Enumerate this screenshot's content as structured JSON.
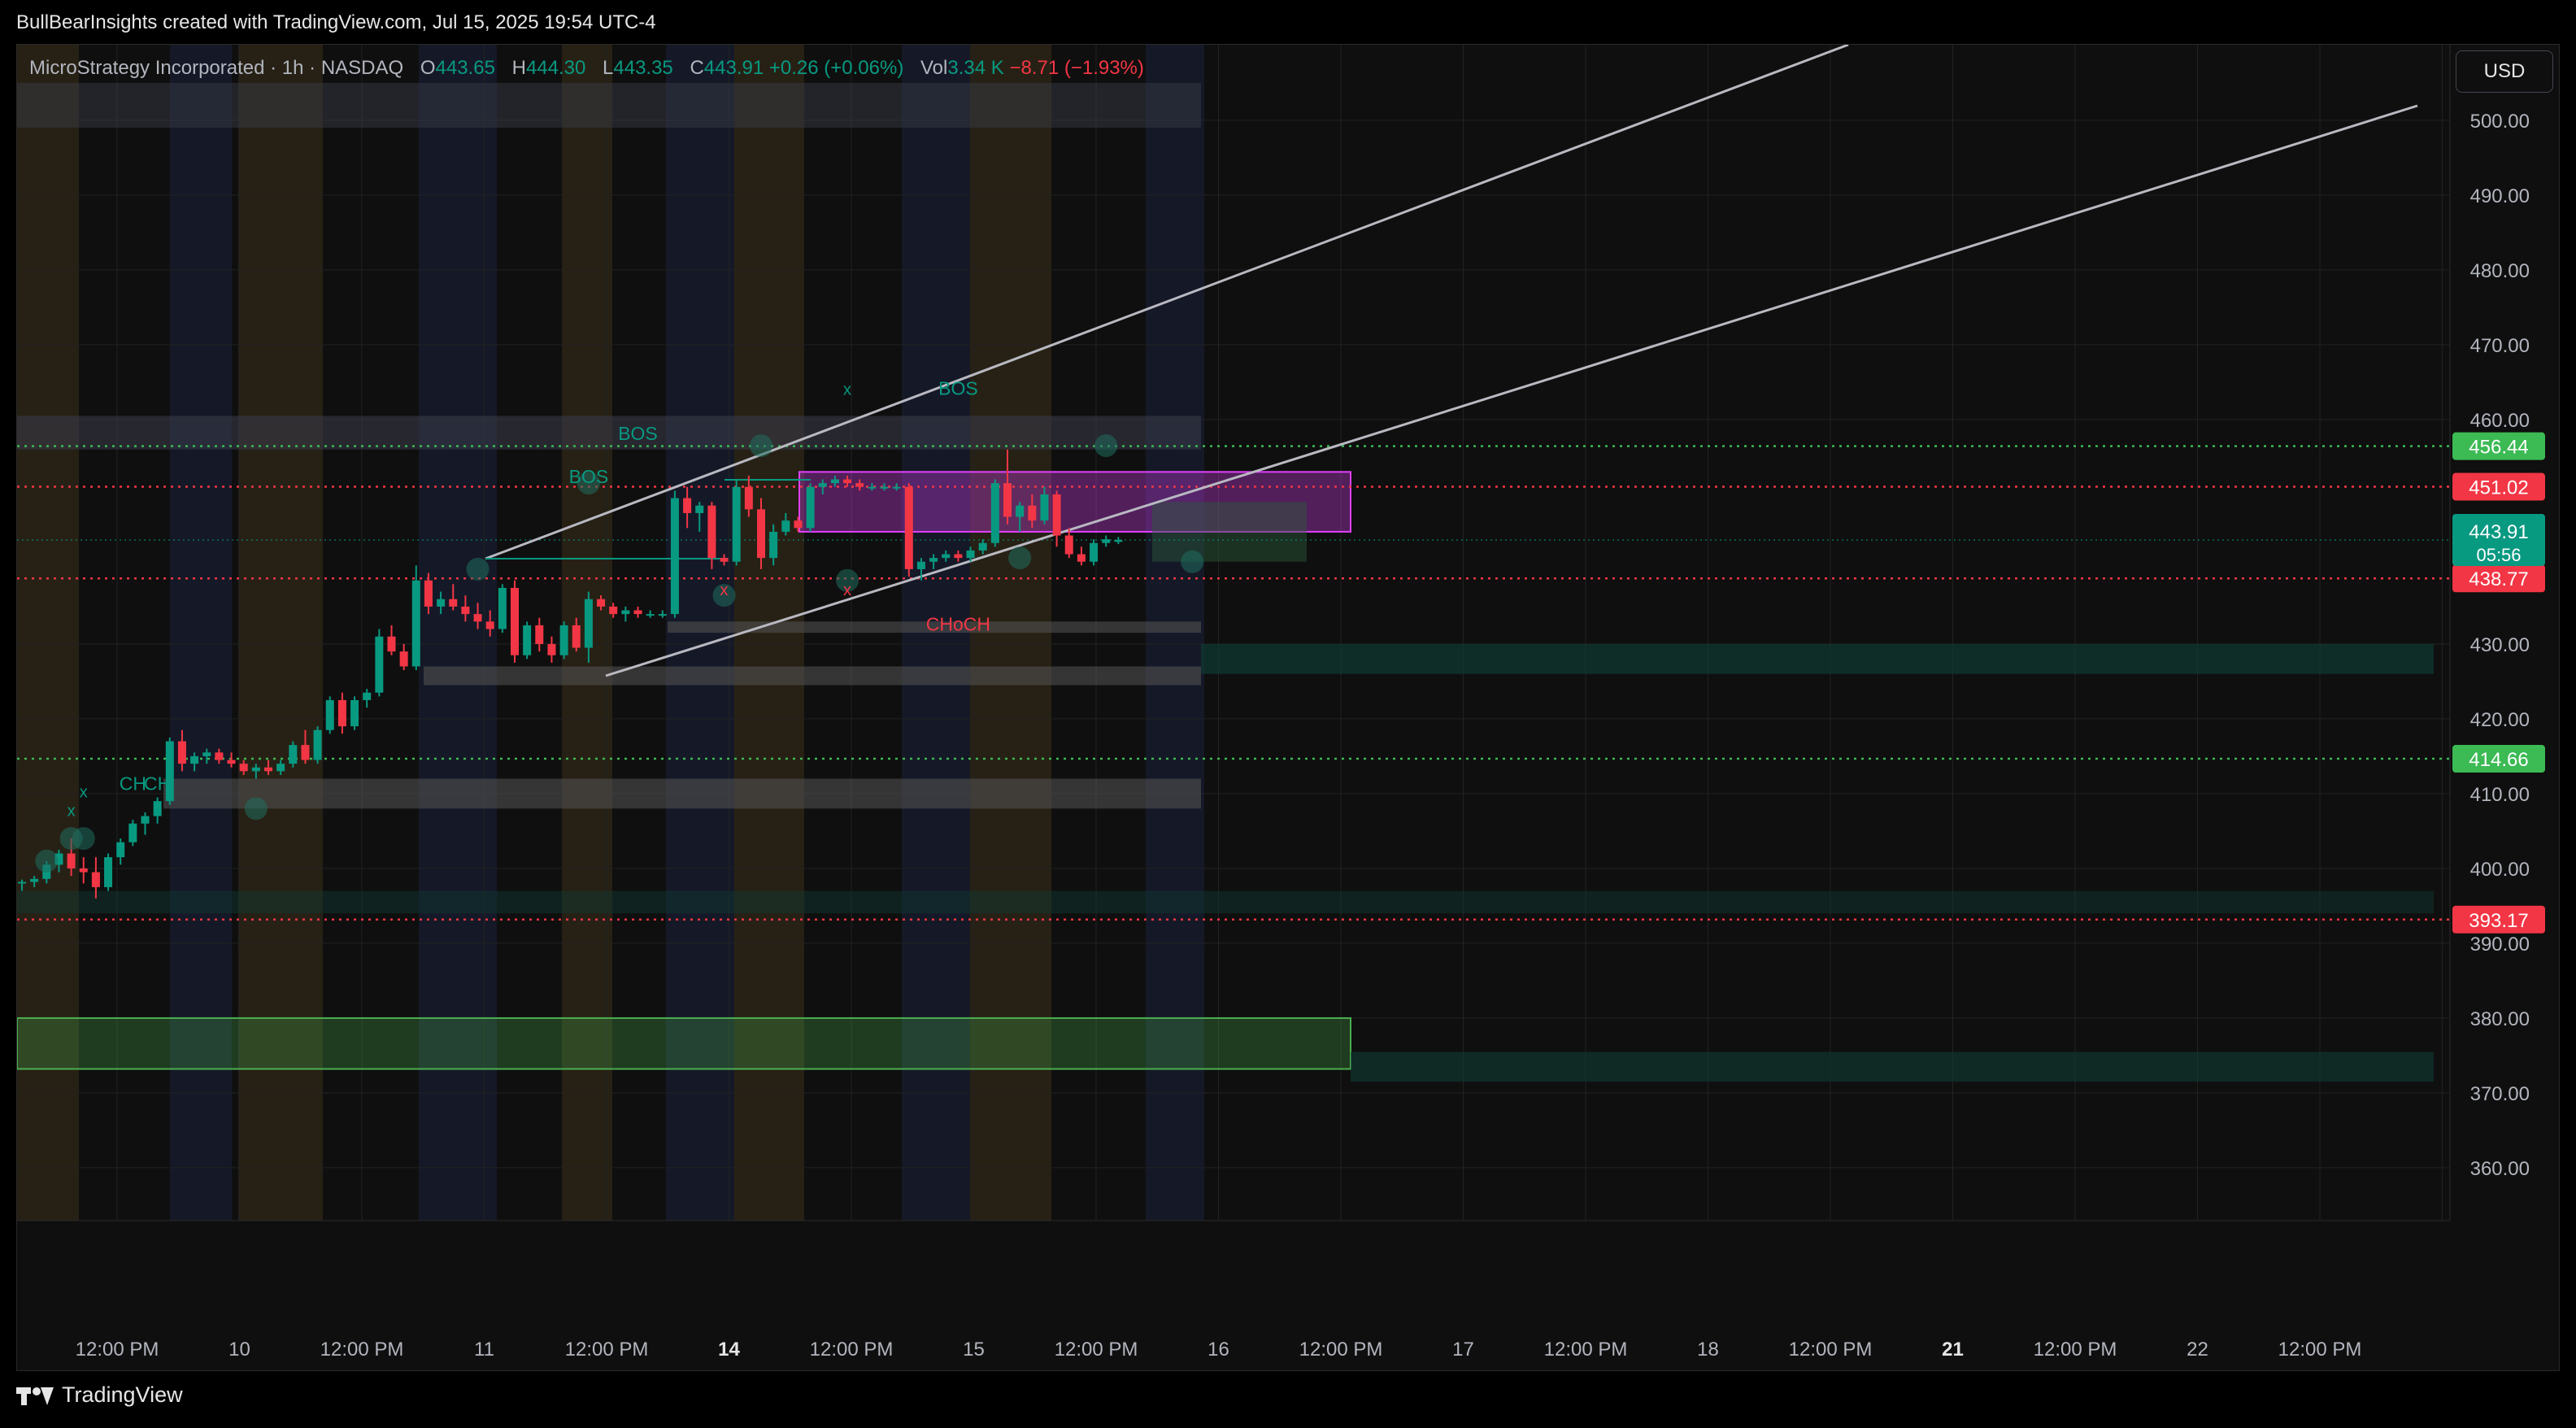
{
  "header": {
    "attribution": "BullBearInsights created with TradingView.com, Jul 15, 2025 19:54 UTC-4"
  },
  "legend": {
    "symbol": "MicroStrategy Incorporated · 1h · NASDAQ",
    "o_label": "O",
    "o_value": "443.65",
    "h_label": "H",
    "h_value": "444.30",
    "l_label": "L",
    "l_value": "443.35",
    "c_label": "C",
    "c_value": "443.91",
    "change": "+0.26 (+0.06%)",
    "vol_label": "Vol",
    "vol_value": "3.34 K",
    "vol_change": "−8.71 (−1.93%)"
  },
  "currency": "USD",
  "footer": {
    "brand": "TradingView"
  },
  "colors": {
    "up": "#089981",
    "down": "#f23645",
    "green_level": "#3cba54",
    "red_level": "#f23645",
    "channel": "#b9b9c2",
    "fvg_magenta": "#e040fb",
    "demand_green": "#4caf50"
  },
  "chart_data": {
    "type": "candlestick",
    "timeframe": "1h",
    "ylim": [
      345,
      505
    ],
    "y_ticks": [
      500,
      490,
      480,
      470,
      460,
      430,
      420,
      410,
      400,
      390,
      380,
      370,
      360
    ],
    "x_ticks": [
      {
        "label": "12:00 PM",
        "bold": false
      },
      {
        "label": "10",
        "bold": false
      },
      {
        "label": "12:00 PM",
        "bold": false
      },
      {
        "label": "11",
        "bold": false
      },
      {
        "label": "12:00 PM",
        "bold": false
      },
      {
        "label": "14",
        "bold": true
      },
      {
        "label": "12:00 PM",
        "bold": false
      },
      {
        "label": "15",
        "bold": false
      },
      {
        "label": "12:00 PM",
        "bold": false
      },
      {
        "label": "16",
        "bold": false
      },
      {
        "label": "12:00 PM",
        "bold": false
      },
      {
        "label": "17",
        "bold": false
      },
      {
        "label": "12:00 PM",
        "bold": false
      },
      {
        "label": "18",
        "bold": false
      },
      {
        "label": "12:00 PM",
        "bold": false
      },
      {
        "label": "21",
        "bold": true
      },
      {
        "label": "12:00 PM",
        "bold": false
      },
      {
        "label": "22",
        "bold": false
      },
      {
        "label": "12:00 PM",
        "bold": false
      }
    ],
    "price_levels": [
      {
        "value": 456.44,
        "label": "456.44",
        "color": "#3cba54"
      },
      {
        "value": 451.02,
        "label": "451.02",
        "color": "#f23645"
      },
      {
        "value": 438.77,
        "label": "438.77",
        "color": "#f23645"
      },
      {
        "value": 414.66,
        "label": "414.66",
        "color": "#3cba54"
      },
      {
        "value": 393.17,
        "label": "393.17",
        "color": "#f23645"
      }
    ],
    "last_price": {
      "value": 443.91,
      "label": "443.91",
      "countdown": "05:56"
    },
    "candles": [
      [
        398.0,
        398.5,
        397.0,
        398.2
      ],
      [
        398.2,
        399.0,
        397.5,
        398.6
      ],
      [
        398.6,
        401.0,
        398.0,
        400.5
      ],
      [
        400.5,
        402.5,
        399.5,
        402.0
      ],
      [
        402.0,
        404.0,
        399.0,
        400.0
      ],
      [
        400.0,
        401.5,
        398.0,
        399.5
      ],
      [
        399.5,
        401.5,
        396.0,
        397.5
      ],
      [
        397.5,
        402.0,
        397.0,
        401.5
      ],
      [
        401.5,
        404.0,
        400.5,
        403.5
      ],
      [
        403.5,
        406.5,
        403.0,
        406.0
      ],
      [
        406.0,
        407.5,
        404.5,
        407.0
      ],
      [
        407.0,
        409.5,
        406.0,
        409.0
      ],
      [
        409.0,
        417.5,
        408.5,
        417.0
      ],
      [
        417.0,
        418.5,
        413.0,
        414.0
      ],
      [
        414.0,
        415.5,
        413.0,
        415.0
      ],
      [
        415.0,
        416.0,
        414.0,
        415.5
      ],
      [
        415.5,
        416.0,
        414.0,
        414.5
      ],
      [
        414.5,
        415.5,
        413.5,
        414.0
      ],
      [
        414.0,
        414.5,
        412.5,
        413.0
      ],
      [
        413.0,
        414.0,
        412.0,
        413.5
      ],
      [
        413.5,
        414.5,
        412.5,
        413.0
      ],
      [
        413.0,
        414.5,
        412.5,
        414.0
      ],
      [
        414.0,
        417.0,
        413.5,
        416.5
      ],
      [
        416.5,
        418.5,
        414.0,
        414.5
      ],
      [
        414.5,
        419.0,
        414.0,
        418.5
      ],
      [
        418.5,
        423.0,
        418.0,
        422.5
      ],
      [
        422.5,
        423.5,
        418.0,
        419.0
      ],
      [
        419.0,
        423.0,
        418.5,
        422.5
      ],
      [
        422.5,
        424.0,
        421.5,
        423.5
      ],
      [
        423.5,
        432.0,
        423.0,
        431.0
      ],
      [
        431.0,
        432.5,
        428.5,
        429.0
      ],
      [
        429.0,
        430.0,
        426.5,
        427.0
      ],
      [
        427.0,
        440.5,
        426.5,
        438.5
      ],
      [
        438.5,
        439.5,
        434.0,
        435.0
      ],
      [
        435.0,
        437.0,
        434.0,
        436.0
      ],
      [
        436.0,
        438.0,
        434.5,
        435.0
      ],
      [
        435.0,
        436.5,
        433.0,
        434.0
      ],
      [
        434.0,
        435.5,
        432.0,
        433.0
      ],
      [
        433.0,
        434.5,
        431.0,
        432.0
      ],
      [
        432.0,
        438.0,
        431.5,
        437.5
      ],
      [
        437.5,
        438.5,
        427.5,
        428.5
      ],
      [
        428.5,
        433.0,
        428.0,
        432.5
      ],
      [
        432.5,
        433.5,
        429.0,
        430.0
      ],
      [
        430.0,
        431.0,
        427.5,
        428.5
      ],
      [
        428.5,
        433.0,
        428.0,
        432.5
      ],
      [
        432.5,
        433.5,
        429.0,
        429.5
      ],
      [
        429.5,
        437.0,
        427.5,
        436.0
      ],
      [
        436.0,
        436.5,
        434.5,
        435.0
      ],
      [
        435.0,
        435.5,
        433.5,
        434.0
      ],
      [
        434.0,
        435.0,
        433.0,
        434.5
      ],
      [
        434.5,
        435.0,
        433.5,
        434.0
      ],
      [
        434.0,
        434.5,
        433.5,
        434.0
      ],
      [
        434.0,
        434.5,
        433.5,
        434.0
      ],
      [
        434.0,
        450.5,
        433.5,
        449.5
      ],
      [
        449.5,
        451.0,
        445.5,
        447.5
      ],
      [
        447.5,
        449.0,
        445.0,
        448.5
      ],
      [
        448.5,
        449.0,
        440.0,
        441.5
      ],
      [
        441.5,
        442.0,
        440.5,
        441.0
      ],
      [
        441.0,
        452.0,
        440.5,
        451.0
      ],
      [
        451.0,
        452.5,
        447.0,
        448.0
      ],
      [
        448.0,
        449.5,
        440.0,
        441.5
      ],
      [
        441.5,
        446.0,
        440.5,
        445.0
      ],
      [
        445.0,
        447.5,
        444.5,
        446.5
      ],
      [
        446.5,
        447.0,
        445.0,
        445.5
      ],
      [
        445.5,
        451.5,
        445.0,
        451.0
      ],
      [
        451.0,
        452.0,
        450.0,
        451.5
      ],
      [
        451.5,
        452.5,
        451.0,
        452.0
      ],
      [
        452.0,
        452.5,
        451.0,
        451.5
      ],
      [
        451.5,
        452.0,
        450.5,
        451.0
      ],
      [
        451.0,
        451.5,
        450.5,
        451.0
      ],
      [
        451.0,
        451.5,
        450.5,
        451.0
      ],
      [
        451.0,
        451.5,
        450.5,
        451.0
      ],
      [
        451.0,
        451.5,
        439.0,
        440.0
      ],
      [
        440.0,
        441.5,
        438.5,
        441.0
      ],
      [
        441.0,
        442.0,
        440.0,
        441.5
      ],
      [
        441.5,
        442.5,
        441.0,
        442.0
      ],
      [
        442.0,
        442.5,
        441.0,
        441.5
      ],
      [
        441.5,
        443.0,
        441.0,
        442.5
      ],
      [
        442.5,
        444.0,
        442.0,
        443.5
      ],
      [
        443.5,
        452.0,
        443.0,
        451.5
      ],
      [
        451.5,
        456.0,
        446.0,
        447.0
      ],
      [
        447.0,
        449.0,
        445.0,
        448.5
      ],
      [
        448.5,
        450.0,
        445.5,
        446.5
      ],
      [
        446.5,
        451.0,
        446.0,
        450.0
      ],
      [
        450.0,
        450.5,
        443.0,
        444.5
      ],
      [
        444.5,
        445.5,
        441.5,
        442.0
      ],
      [
        442.0,
        443.0,
        440.5,
        441.0
      ],
      [
        441.0,
        444.0,
        440.5,
        443.5
      ],
      [
        443.5,
        444.5,
        443.0,
        444.0
      ],
      [
        443.65,
        444.3,
        443.35,
        443.91
      ]
    ],
    "annotations": [
      {
        "text": "BOS",
        "color": "#089981",
        "bar": 46,
        "price": 451.5
      },
      {
        "text": "BOS",
        "color": "#089981",
        "bar": 50,
        "price": 457.3
      },
      {
        "text": "BOS",
        "color": "#089981",
        "bar": 76,
        "price": 463.3
      },
      {
        "text": "CHoCH",
        "color": "#f23645",
        "bar": 76,
        "price": 431.8
      },
      {
        "text": "CH",
        "color": "#089981",
        "bar": 9,
        "price": 410.5
      },
      {
        "text": "CH",
        "color": "#089981",
        "bar": 11,
        "price": 410.5
      },
      {
        "text": "x",
        "color": "#089981",
        "bar": 5,
        "price": 409.5
      },
      {
        "text": "x",
        "color": "#089981",
        "bar": 4,
        "price": 407.0
      },
      {
        "text": "x",
        "color": "#089981",
        "bar": 67,
        "price": 463.3
      },
      {
        "text": "x",
        "color": "#f23645",
        "bar": 57,
        "price": 436.5
      },
      {
        "text": "x",
        "color": "#f23645",
        "bar": 67,
        "price": 436.5
      }
    ]
  }
}
